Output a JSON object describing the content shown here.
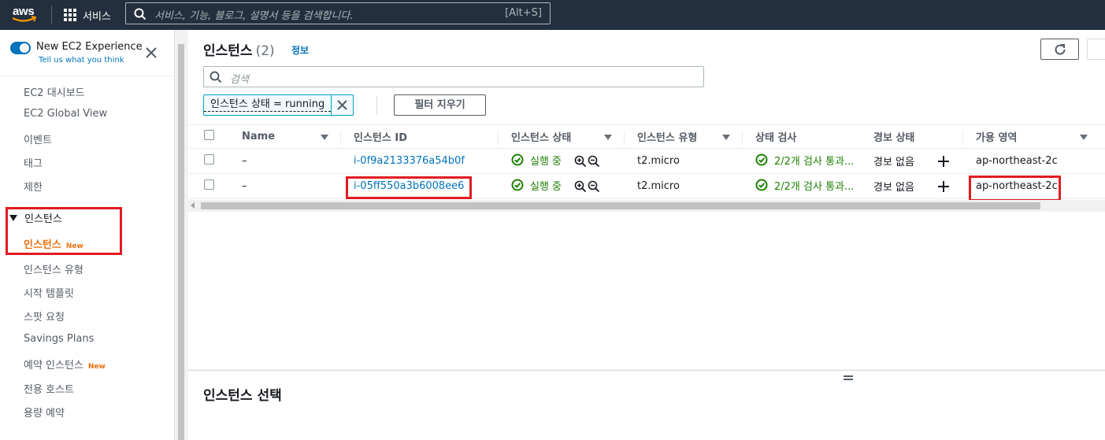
{
  "topnav": {
    "logo": "aws",
    "services_label": "서비스",
    "search_placeholder": "서비스, 기능, 블로그, 설명서 등을 검색합니다.",
    "search_shortcut": "[Alt+S]"
  },
  "sidebar": {
    "experience_title": "New EC2 Experience",
    "experience_sub": "Tell us what you think",
    "items_top": [
      "EC2 대시보드",
      "EC2 Global View",
      "이벤트",
      "태그",
      "제한"
    ],
    "section_label": "인스턴스",
    "active_item": "인스턴스",
    "active_badge": "New",
    "items_sub": [
      "인스턴스 유형",
      "시작 템플릿",
      "스팟 요청",
      "Savings Plans"
    ],
    "reserved_label": "예약 인스턴스",
    "reserved_badge": "New",
    "items_bottom": [
      "전용 호스트",
      "용량 예약"
    ]
  },
  "main": {
    "title": "인스턴스",
    "count": "(2)",
    "info_link": "정보",
    "search_placeholder": "검색",
    "filter_token": "인스턴스 상태 = running",
    "clear_filters": "필터 지우기",
    "columns": [
      "Name",
      "인스턴스 ID",
      "인스턴스 상태",
      "인스턴스 유형",
      "상태 검사",
      "경보 상태",
      "가용 영역"
    ],
    "rows": [
      {
        "name": "–",
        "id": "i-0f9a2133376a54b0f",
        "state": "실행 중",
        "type": "t2.micro",
        "check": "2/2개 검사 통과...",
        "alarm": "경보 없음",
        "az": "ap-northeast-2c"
      },
      {
        "name": "–",
        "id": "i-05ff550a3b6008ee6",
        "state": "실행 중",
        "type": "t2.micro",
        "check": "2/2개 검사 통과...",
        "alarm": "경보 없음",
        "az": "ap-northeast-2c"
      }
    ],
    "bottom_title": "인스턴스 선택"
  },
  "colors": {
    "nav_bg": "#232f3e",
    "link": "#0073bb",
    "active": "#ec7211",
    "success": "#1d8102",
    "highlight": "#e01b22"
  }
}
